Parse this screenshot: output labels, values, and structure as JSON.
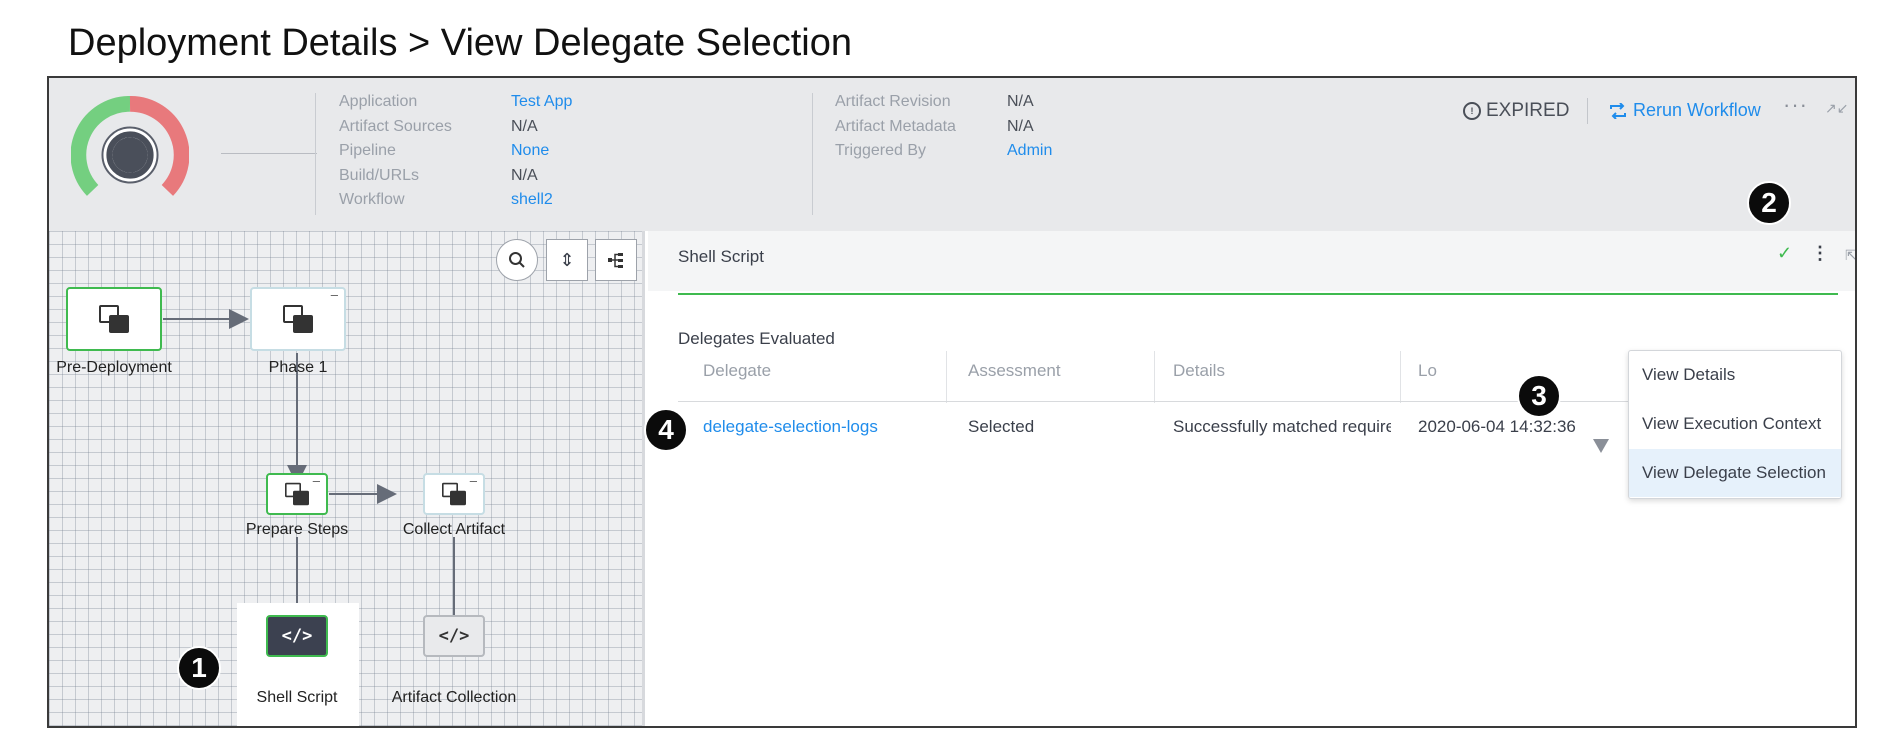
{
  "page_title": "Deployment Details > View Delegate Selection",
  "header": {
    "info_left": [
      {
        "label": "Application",
        "value": "Test App",
        "link": true
      },
      {
        "label": "Artifact Sources",
        "value": "N/A",
        "link": false
      },
      {
        "label": "Pipeline",
        "value": "None",
        "link": true
      },
      {
        "label": "Build/URLs",
        "value": "N/A",
        "link": false
      },
      {
        "label": "Workflow",
        "value": "shell2",
        "link": true
      }
    ],
    "info_right": [
      {
        "label": "Artifact Revision",
        "value": "N/A",
        "link": false
      },
      {
        "label": "Artifact Metadata",
        "value": "N/A",
        "link": false
      },
      {
        "label": "Triggered By",
        "value": "Admin",
        "link": true
      }
    ],
    "status": "EXPIRED",
    "rerun_label": "Rerun Workflow",
    "more_icon": "···",
    "gauge_colors": {
      "success": "#74cf80",
      "failure": "#e8797c",
      "center": "#5a5f6b"
    }
  },
  "graph": {
    "nodes": {
      "pre_deployment": "Pre-Deployment",
      "phase_1": "Phase 1",
      "prepare_steps": "Prepare Steps",
      "collect_artifact": "Collect Artifact",
      "shell_script": "Shell Script",
      "artifact_collection": "Artifact Collection"
    },
    "code_glyph": "</>"
  },
  "details": {
    "title": "Shell Script",
    "section_title": "Delegates Evaluated",
    "columns": [
      "Delegate",
      "Assessment",
      "Details",
      "Lo"
    ],
    "rows": [
      {
        "delegate": "delegate-selection-logs",
        "assessment": "Selected",
        "details": "Successfully matched required d",
        "log_time": "2020-06-04 14:32:36"
      }
    ]
  },
  "menu": {
    "items": [
      "View Details",
      "View Execution Context",
      "View Delegate Selection"
    ]
  },
  "callouts": [
    "1",
    "2",
    "3",
    "4"
  ],
  "colors": {
    "accent": "#1f8ceb",
    "success": "#3fba4f"
  }
}
